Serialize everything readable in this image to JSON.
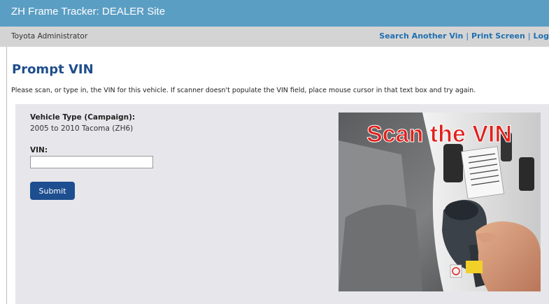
{
  "app": {
    "title": "ZH Frame Tracker: DEALER Site"
  },
  "subbar": {
    "user": "Toyota Administrator",
    "links": [
      "Search Another Vin",
      "Print Screen",
      "Log"
    ],
    "separator": "|"
  },
  "page": {
    "heading": "Prompt VIN",
    "instructions": "Please scan, or type in, the VIN for this vehicle. If scanner doesn't populate the VIN field, place mouse cursor in that text box and try again."
  },
  "form": {
    "vehicle_type_label": "Vehicle Type (Campaign):",
    "vehicle_type_value": "2005 to 2010 Tacoma (ZH6)",
    "vin_label": "VIN:",
    "vin_value": "",
    "submit_label": "Submit"
  },
  "photo": {
    "overlay_text": "Scan the VIN",
    "overlay_color": "#e0221e"
  },
  "colors": {
    "topbar": "#5b9ec4",
    "subbar": "#d4d4d4",
    "link": "#1f6fb0",
    "heading": "#1f4e8c",
    "panel": "#e7e6ea",
    "button": "#1d4e8f"
  }
}
